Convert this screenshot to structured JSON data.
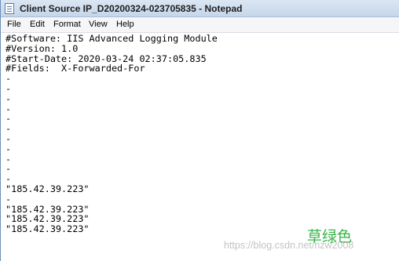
{
  "window": {
    "title": "Client Source IP_D20200324-023705835 - Notepad"
  },
  "menu": [
    "File",
    "Edit",
    "Format",
    "View",
    "Help"
  ],
  "editor": {
    "lines": [
      "#Software: IIS Advanced Logging Module",
      "#Version: 1.0",
      "#Start-Date: 2020-03-24 02:37:05.835",
      "#Fields:  X-Forwarded-For",
      "-",
      "-",
      "-",
      "-",
      "-",
      "-",
      "-",
      "-",
      "-",
      "-",
      "-",
      "\"185.42.39.223\"",
      "-",
      "\"185.42.39.223\"",
      "\"185.42.39.223\"",
      "\"185.42.39.223\""
    ]
  },
  "overlay_label": "草绿色",
  "watermark": "https://blog.csdn.net/nzw2008"
}
